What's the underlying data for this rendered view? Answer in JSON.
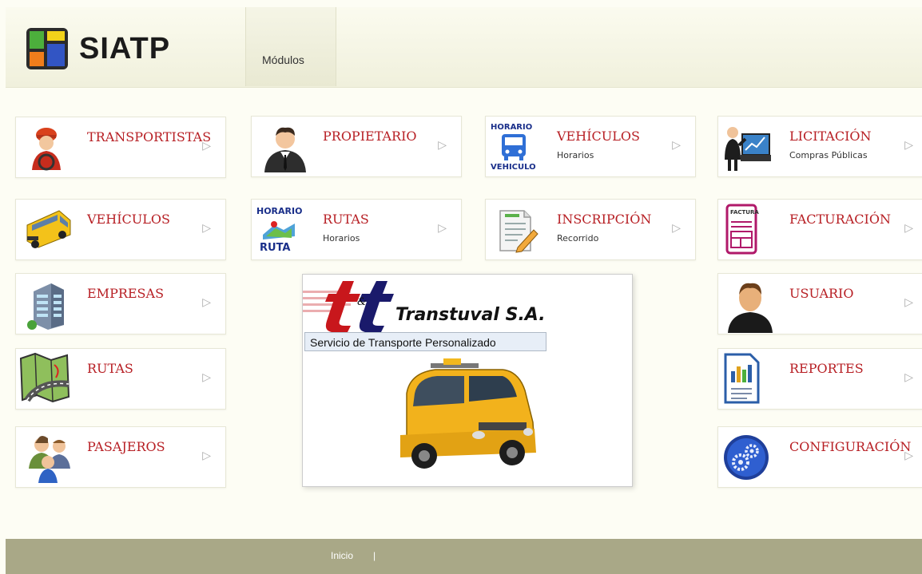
{
  "header": {
    "app_name": "SIATP",
    "tab_label": "Módulos"
  },
  "cards": {
    "transportistas": {
      "title": "TRANSPORTISTAS",
      "icon": "driver-icon"
    },
    "propietario": {
      "title": "PROPIETARIO",
      "icon": "businessman-icon"
    },
    "vehiculos_horarios": {
      "title": "VEHÍCULOS",
      "subtitle": "Horarios",
      "icon": "horario-vehiculo-icon",
      "icon_top": "HORARIO",
      "icon_bottom": "VEHICULO"
    },
    "licitacion": {
      "title": "LICITACIÓN",
      "subtitle": "Compras Públicas",
      "icon": "presentation-icon"
    },
    "vehiculos": {
      "title": "VEHÍCULOS",
      "icon": "school-bus-icon"
    },
    "rutas_horarios": {
      "title": "RUTAS",
      "subtitle": "Horarios",
      "icon": "horario-ruta-icon",
      "icon_top": "HORARIO",
      "icon_bottom": "RUTA"
    },
    "inscripcion": {
      "title": "INSCRIPCIÓN",
      "subtitle": "Recorrido",
      "icon": "document-edit-icon"
    },
    "facturacion": {
      "title": "FACTURACIÓN",
      "icon": "invoice-icon",
      "icon_label": "FACTURA"
    },
    "empresas": {
      "title": "EMPRESAS",
      "icon": "building-icon"
    },
    "usuario": {
      "title": "USUARIO",
      "icon": "user-icon"
    },
    "rutas": {
      "title": "RUTAS",
      "icon": "map-icon"
    },
    "reportes": {
      "title": "REPORTES",
      "icon": "report-icon"
    },
    "pasajeros": {
      "title": "PASAJEROS",
      "icon": "passengers-icon"
    },
    "configuracion": {
      "title": "CONFIGURACIÓN",
      "icon": "gears-icon"
    }
  },
  "banner": {
    "logo_letters": "t&t",
    "company_name": "Transtuval S.A.",
    "slogan": "Servicio de Transporte Personalizado"
  },
  "footer": {
    "home_link": "Inicio",
    "separator": "|"
  },
  "colors": {
    "title_red": "#b71f24",
    "footer_bg": "#a9a887",
    "page_bg": "#fdfdf4"
  }
}
